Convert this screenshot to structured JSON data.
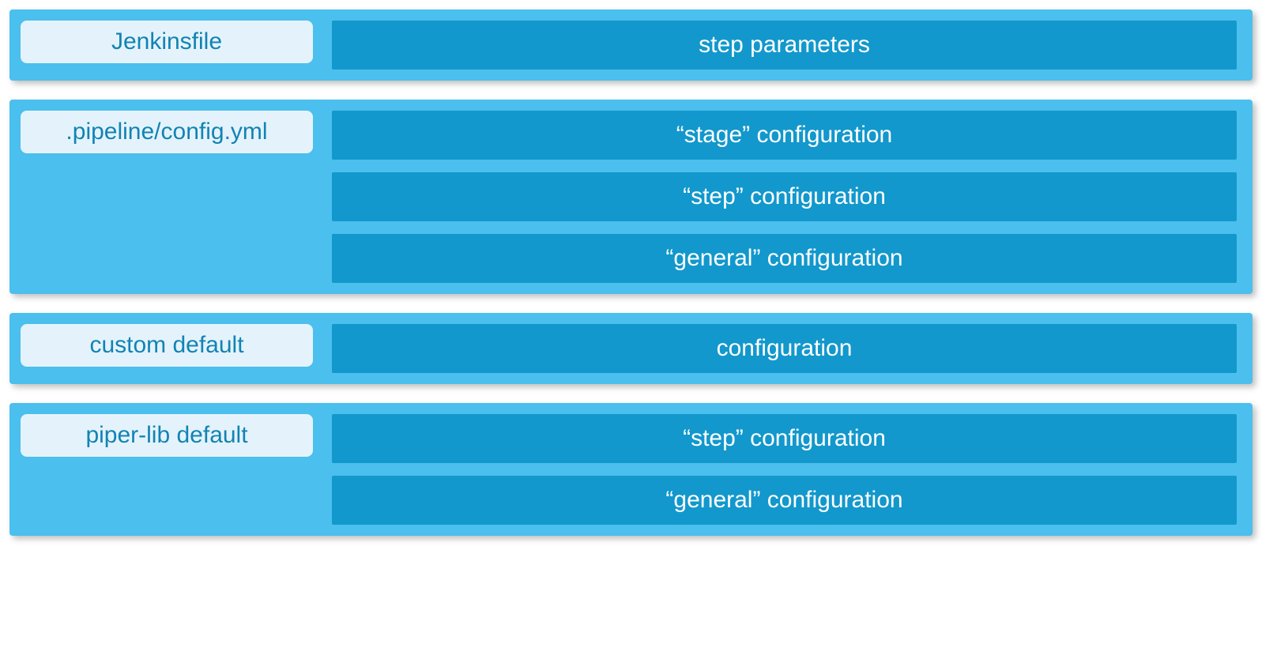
{
  "layers": [
    {
      "label": "Jenkinsfile",
      "items": [
        "step parameters"
      ]
    },
    {
      "label": ".pipeline/config.yml",
      "items": [
        "“stage” configuration",
        "“step” configuration",
        "“general” configuration"
      ]
    },
    {
      "label": "custom default",
      "items": [
        "configuration"
      ]
    },
    {
      "label": "piper-lib default",
      "items": [
        "“step” configuration",
        "“general” configuration"
      ]
    }
  ]
}
